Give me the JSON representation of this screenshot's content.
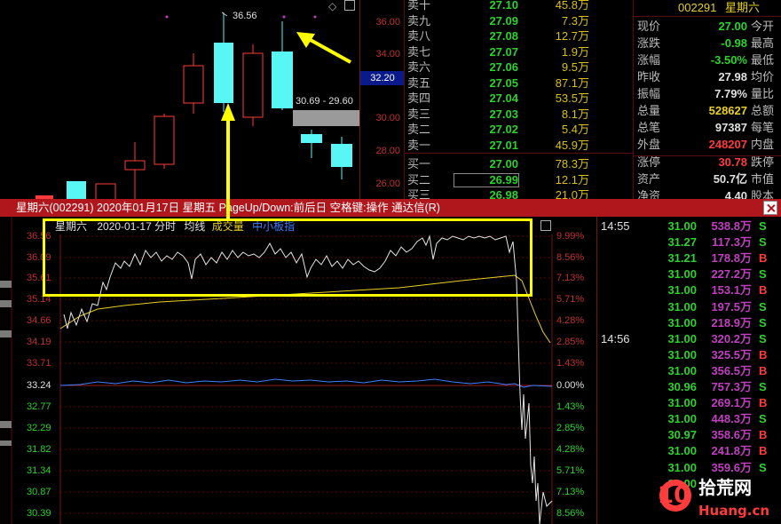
{
  "kline": {
    "axis_ticks": [
      "36.00",
      "34.00",
      "30.00",
      "28.00",
      "26.00"
    ],
    "highlight_price": "32.20",
    "high_label": "36.56",
    "range_label": "30.69 - 29.60"
  },
  "orderbook": {
    "asks": [
      {
        "label": "卖十",
        "price": "27.10",
        "vol": "45.8万"
      },
      {
        "label": "卖九",
        "price": "27.09",
        "vol": "7.3万"
      },
      {
        "label": "卖八",
        "price": "27.08",
        "vol": "12.7万"
      },
      {
        "label": "卖七",
        "price": "27.07",
        "vol": "1.9万"
      },
      {
        "label": "卖六",
        "price": "27.06",
        "vol": "9.5万"
      },
      {
        "label": "卖五",
        "price": "27.05",
        "vol": "87.1万"
      },
      {
        "label": "卖四",
        "price": "27.04",
        "vol": "53.5万"
      },
      {
        "label": "卖三",
        "price": "27.03",
        "vol": "8.1万"
      },
      {
        "label": "卖二",
        "price": "27.02",
        "vol": "5.4万"
      },
      {
        "label": "卖一",
        "price": "27.01",
        "vol": "45.9万"
      }
    ],
    "bids": [
      {
        "label": "买一",
        "price": "27.00",
        "vol": "78.3万"
      },
      {
        "label": "买二",
        "price": "26.99",
        "vol": "12.1万"
      },
      {
        "label": "买三",
        "price": "26.98",
        "vol": "21.0万"
      }
    ]
  },
  "quote": {
    "code": "002291",
    "name": "星期六",
    "rows": [
      {
        "l1": "现价",
        "v1": "27.00",
        "c": "green",
        "l2": "今开"
      },
      {
        "l1": "涨跌",
        "v1": "-0.98",
        "c": "green",
        "l2": "最高"
      },
      {
        "l1": "涨幅",
        "v1": "-3.50%",
        "c": "green",
        "l2": "最低"
      },
      {
        "l1": "昨收",
        "v1": "27.98",
        "c": "white",
        "l2": "均价"
      },
      {
        "l1": "振幅",
        "v1": "7.79%",
        "c": "white",
        "l2": "量比"
      },
      {
        "l1": "总量",
        "v1": "528627",
        "c": "yellow",
        "l2": "总额"
      },
      {
        "l1": "总笔",
        "v1": "97387",
        "c": "white",
        "l2": "每笔"
      },
      {
        "l1": "外盘",
        "v1": "248207",
        "c": "red",
        "l2": "内盘"
      },
      {
        "l1": "涨停",
        "v1": "30.78",
        "c": "red",
        "l2": "跌停"
      },
      {
        "l1": "资产",
        "v1": "50.7亿",
        "c": "white",
        "l2": "市值"
      },
      {
        "l1": "净资",
        "v1": "4.40",
        "c": "white",
        "l2": "股本"
      }
    ]
  },
  "popup": {
    "title": "星期六(002291) 2020年01月17日 星期五 PageUp/Down:前后日 空格键:操作 通达信(R)",
    "stock": "星期六",
    "date_label": "2020-01-17 分时",
    "avg_label": "均线",
    "vol_label": "成交量",
    "index_label": "中小板指",
    "left_axis": [
      "36.56",
      "36.09",
      "35.61",
      "35.14",
      "34.66",
      "34.19",
      "33.71",
      "33.24",
      "32.77",
      "32.29",
      "31.82",
      "31.34",
      "30.87",
      "30.39"
    ],
    "right_axis": [
      "9.99%",
      "8.56%",
      "7.13%",
      "5.71%",
      "4.28%",
      "2.85%",
      "1.43%",
      "0.00%",
      "1.43%",
      "2.85%",
      "4.28%",
      "5.71%",
      "7.13%",
      "8.56%"
    ]
  },
  "ticks": [
    {
      "time": "14:55",
      "price": "31.00",
      "vol": "538.8万",
      "side": "S"
    },
    {
      "time": "",
      "price": "31.27",
      "vol": "117.3万",
      "side": "S"
    },
    {
      "time": "",
      "price": "31.21",
      "vol": "178.8万",
      "side": "B"
    },
    {
      "time": "",
      "price": "31.00",
      "vol": "227.2万",
      "side": "S"
    },
    {
      "time": "",
      "price": "31.00",
      "vol": "153.1万",
      "side": "B"
    },
    {
      "time": "",
      "price": "31.00",
      "vol": "197.5万",
      "side": "S"
    },
    {
      "time": "",
      "price": "31.00",
      "vol": "218.9万",
      "side": "S"
    },
    {
      "time": "14:56",
      "price": "31.00",
      "vol": "320.2万",
      "side": "S"
    },
    {
      "time": "",
      "price": "31.00",
      "vol": "325.5万",
      "side": "B"
    },
    {
      "time": "",
      "price": "31.00",
      "vol": "356.5万",
      "side": "B"
    },
    {
      "time": "",
      "price": "30.96",
      "vol": "757.3万",
      "side": "S"
    },
    {
      "time": "",
      "price": "31.00",
      "vol": "269.1万",
      "side": "B"
    },
    {
      "time": "",
      "price": "31.00",
      "vol": "448.3万",
      "side": "S"
    },
    {
      "time": "",
      "price": "30.97",
      "vol": "358.6万",
      "side": "B"
    },
    {
      "time": "",
      "price": "31.00",
      "vol": "241.8万",
      "side": "B"
    },
    {
      "time": "",
      "price": "31.00",
      "vol": "359.6万",
      "side": "S"
    },
    {
      "time": "",
      "price": "31.00",
      "vol": "",
      "side": ""
    }
  ],
  "watermark": {
    "num": "10",
    "cn": "拾荒网",
    "en": "Huang.cn"
  },
  "colors": {
    "up": "#ff3b3b",
    "down": "#2ed12e",
    "cyan": "#59f6f6",
    "yellow": "#ffff00",
    "avg_line": "#e8d020",
    "title_bar": "#b0171d"
  }
}
